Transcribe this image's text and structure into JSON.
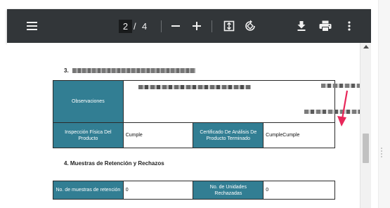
{
  "toolbar": {
    "current_page": "2",
    "page_separator": "/",
    "total_pages": "4",
    "icons": [
      "menu-icon",
      "zoom-out-icon",
      "zoom-in-icon",
      "fit-to-page-icon",
      "rotate-icon",
      "download-icon",
      "print-icon",
      "more-options-icon"
    ]
  },
  "document": {
    "section3_heading": "3.",
    "table1": {
      "observaciones_label": "Observaciones",
      "inspeccion_label": "Inspección Física Del Producto",
      "inspeccion_value": "Cumple",
      "certificado_label": "Certificado De Análisis De Producto Terminado",
      "certificado_value": "CumpleCumple"
    },
    "section4_heading": "4.   Muestras de Retención y Rechazos",
    "table2": {
      "muestras_label": "No. de muestras de retención",
      "muestras_value": "0",
      "unidades_label": "No. de Unidades Rechazadas",
      "unidades_value": "0"
    }
  },
  "colors": {
    "toolbar_bg": "#323639",
    "table_header_bg": "#327e93",
    "annotation_arrow": "#e8275a"
  }
}
